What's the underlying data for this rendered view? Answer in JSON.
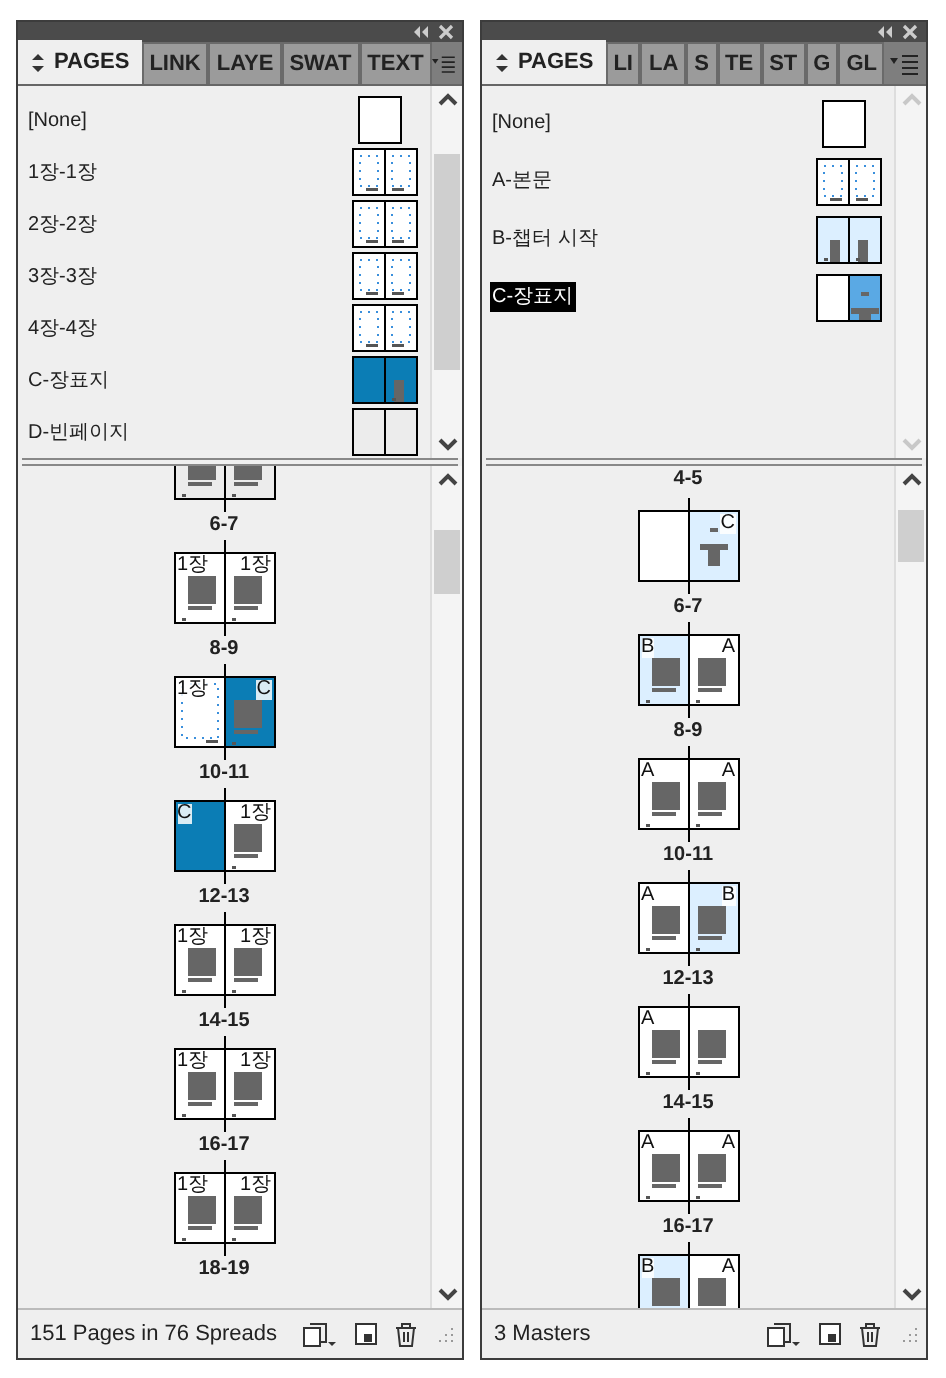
{
  "panels": [
    {
      "tabs": [
        {
          "label": "PAGES",
          "selected": true
        },
        {
          "label": "LINK",
          "selected": false
        },
        {
          "label": "LAYE",
          "selected": false
        },
        {
          "label": "SWAT",
          "selected": false
        },
        {
          "label": "TEXT",
          "selected": false
        }
      ],
      "masters": [
        {
          "name": "[None]",
          "selected": false,
          "pages": [
            {
              "kind": "blank"
            }
          ]
        },
        {
          "name": "1장-1장",
          "selected": false,
          "pages": [
            {
              "kind": "margins"
            },
            {
              "kind": "margins"
            }
          ]
        },
        {
          "name": "2장-2장",
          "selected": false,
          "pages": [
            {
              "kind": "margins"
            },
            {
              "kind": "margins"
            }
          ]
        },
        {
          "name": "3장-3장",
          "selected": false,
          "pages": [
            {
              "kind": "margins"
            },
            {
              "kind": "margins"
            }
          ]
        },
        {
          "name": "4장-4장",
          "selected": false,
          "pages": [
            {
              "kind": "margins"
            },
            {
              "kind": "margins"
            }
          ]
        },
        {
          "name": "C-장표지",
          "selected": false,
          "pages": [
            {
              "kind": "blue"
            },
            {
              "kind": "bluetext"
            }
          ]
        },
        {
          "name": "D-빈페이지",
          "selected": false,
          "pages": [
            {
              "kind": "gray"
            },
            {
              "kind": "gray"
            }
          ]
        }
      ],
      "spreads": [
        {
          "label": "6-7",
          "pages": [
            {
              "kind": "graytext"
            },
            {
              "kind": "graytext"
            }
          ]
        },
        {
          "label": "8-9",
          "pages": [
            {
              "kind": "text",
              "master": "1장"
            },
            {
              "kind": "text",
              "master": "1장"
            }
          ]
        },
        {
          "label": "10-11",
          "pages": [
            {
              "kind": "margins",
              "master": "1장"
            },
            {
              "kind": "bluetext",
              "master": "C"
            }
          ]
        },
        {
          "label": "12-13",
          "pages": [
            {
              "kind": "blue",
              "master": "C"
            },
            {
              "kind": "text",
              "master": "1장"
            }
          ]
        },
        {
          "label": "14-15",
          "pages": [
            {
              "kind": "text",
              "master": "1장"
            },
            {
              "kind": "text",
              "master": "1장"
            }
          ]
        },
        {
          "label": "16-17",
          "pages": [
            {
              "kind": "text",
              "master": "1장"
            },
            {
              "kind": "text",
              "master": "1장"
            }
          ]
        },
        {
          "label": "18-19",
          "pages": [
            {
              "kind": "text",
              "master": "1장"
            },
            {
              "kind": "text",
              "master": "1장"
            }
          ]
        }
      ],
      "status": "151 Pages in 76 Spreads"
    },
    {
      "tabs": [
        {
          "label": "PAGES",
          "selected": true
        },
        {
          "label": "LI",
          "selected": false
        },
        {
          "label": "LA",
          "selected": false
        },
        {
          "label": "S",
          "selected": false
        },
        {
          "label": "TE",
          "selected": false
        },
        {
          "label": "ST",
          "selected": false
        },
        {
          "label": "G",
          "selected": false
        },
        {
          "label": "GL",
          "selected": false
        }
      ],
      "masters": [
        {
          "name": "[None]",
          "selected": false,
          "pages": [
            {
              "kind": "blank"
            }
          ]
        },
        {
          "name": "A-본문",
          "selected": false,
          "pages": [
            {
              "kind": "margins"
            },
            {
              "kind": "margins"
            }
          ]
        },
        {
          "name": "B-챕터 시작",
          "selected": false,
          "pages": [
            {
              "kind": "light"
            },
            {
              "kind": "light"
            }
          ]
        },
        {
          "name": "C-장표지",
          "selected": true,
          "pages": [
            {
              "kind": "blank"
            },
            {
              "kind": "cover"
            }
          ]
        }
      ],
      "spreads": [
        {
          "label": "4-5"
        },
        {
          "label": "6-7",
          "pages": [
            {
              "kind": "blank"
            },
            {
              "kind": "lightcover",
              "master": "C"
            }
          ]
        },
        {
          "label": "8-9",
          "pages": [
            {
              "kind": "light",
              "master": "B"
            },
            {
              "kind": "text",
              "master": "A"
            }
          ]
        },
        {
          "label": "10-11",
          "pages": [
            {
              "kind": "text",
              "master": "A"
            },
            {
              "kind": "text",
              "master": "A"
            }
          ]
        },
        {
          "label": "12-13",
          "pages": [
            {
              "kind": "text",
              "master": "A"
            },
            {
              "kind": "light",
              "master": "B"
            }
          ]
        },
        {
          "label": "14-15",
          "pages": [
            {
              "kind": "text",
              "master": "A"
            },
            {
              "kind": "text"
            }
          ]
        },
        {
          "label": "16-17",
          "pages": [
            {
              "kind": "text",
              "master": "A"
            },
            {
              "kind": "text",
              "master": "A"
            }
          ]
        },
        {
          "pages": [
            {
              "kind": "light",
              "master": "B"
            },
            {
              "kind": "text",
              "master": "A"
            }
          ]
        }
      ],
      "status": "3 Masters"
    }
  ]
}
